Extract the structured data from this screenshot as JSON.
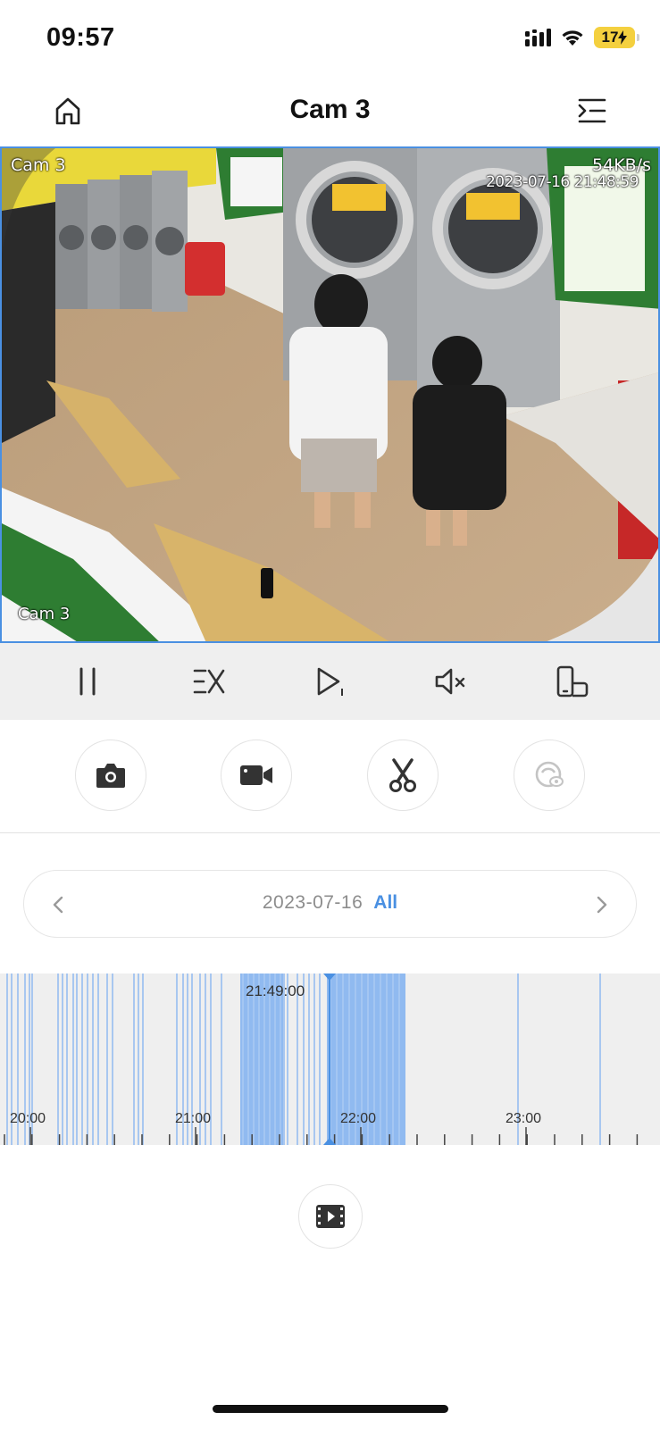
{
  "status_bar": {
    "time": "09:57",
    "battery": "17",
    "icons": [
      "signal-icon",
      "wifi-icon",
      "battery-charging-icon"
    ]
  },
  "nav": {
    "title": "Cam 3",
    "left_icon": "home-icon",
    "right_icon": "menu-icon"
  },
  "video": {
    "osd_cam_top": "Cam 3",
    "osd_speed": "54KB/s",
    "osd_timestamp": "2023-07-16 21:48:59",
    "osd_cam_bottom": "Cam 3"
  },
  "controls": [
    {
      "name": "pause-icon"
    },
    {
      "name": "speed-icon"
    },
    {
      "name": "play-frame-icon"
    },
    {
      "name": "mute-icon"
    },
    {
      "name": "fullscreen-icon"
    }
  ],
  "actions": [
    {
      "name": "snapshot-icon"
    },
    {
      "name": "record-icon"
    },
    {
      "name": "clip-icon"
    },
    {
      "name": "privacy-icon"
    }
  ],
  "date_selector": {
    "date": "2023-07-16",
    "filter": "All"
  },
  "timeline": {
    "cursor_time": "21:49:00",
    "hour_labels": [
      "20:00",
      "21:00",
      "22:00",
      "23:00"
    ]
  },
  "colors": {
    "accent": "#4a90e2",
    "timeline_bg": "#efefef",
    "recording": "#90baf0"
  }
}
